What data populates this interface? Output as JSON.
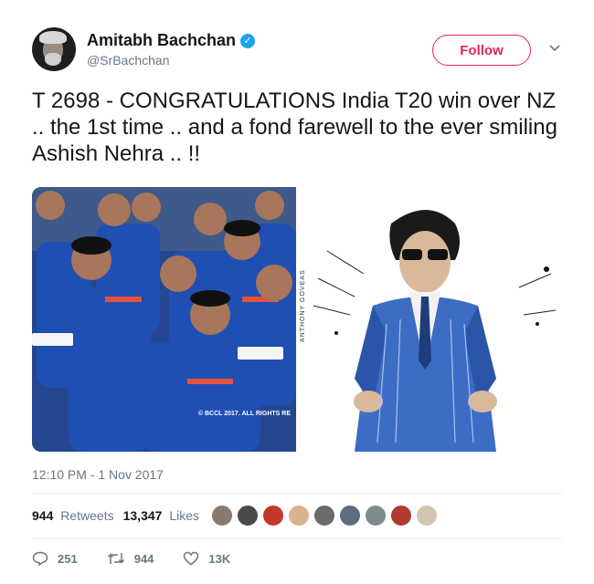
{
  "author": {
    "name": "Amitabh Bachchan",
    "handle": "@SrBachchan",
    "verified_icon": "verified-badge-icon"
  },
  "follow_label": "Follow",
  "tweet_text": "T 2698 - CONGRATULATIONS India T20 win over NZ .. the 1st time .. and a fond farewell to the ever smiling Ashish Nehra .. !!",
  "media": {
    "photo_credit": "© BCCL 2017. ALL RIGHTS RE",
    "artist_signature": "ANTHONY GOVEAS"
  },
  "timestamp": "12:10 PM - 1 Nov 2017",
  "stats": {
    "retweets_count": "944",
    "retweets_label": "Retweets",
    "likes_count": "13,347",
    "likes_label": "Likes"
  },
  "likers": [
    {
      "color": "#8a7a6e"
    },
    {
      "color": "#4a4a4a"
    },
    {
      "color": "#c0392b"
    },
    {
      "color": "#d9b38c"
    },
    {
      "color": "#6b6b6b"
    },
    {
      "color": "#5d6d7e"
    },
    {
      "color": "#7f8c8d"
    },
    {
      "color": "#b03a2e"
    },
    {
      "color": "#d5c4b0"
    }
  ],
  "actions": {
    "reply_count": "251",
    "retweet_count": "944",
    "like_count": "13K"
  },
  "colors": {
    "accent": "#e0245e",
    "verified": "#1da1f2",
    "muted": "#657786"
  }
}
